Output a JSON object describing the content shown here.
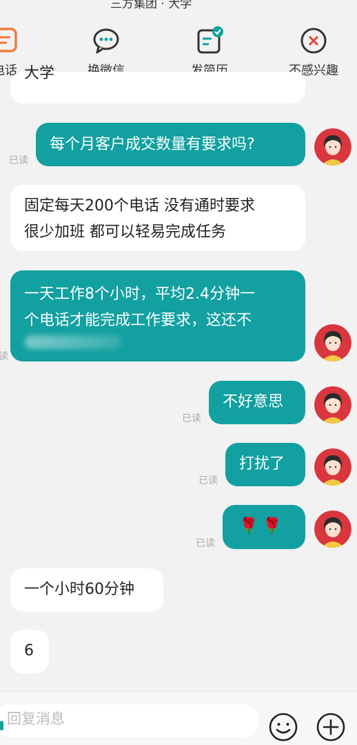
{
  "header": {
    "partial_text": "三方集团 · 大学"
  },
  "actions": [
    {
      "label": "电话",
      "icon": "phone-icon"
    },
    {
      "label": "换微信",
      "icon": "wechat-icon"
    },
    {
      "label": "发简历",
      "icon": "resume-icon"
    },
    {
      "label": "不感兴趣",
      "icon": "not-interested-icon"
    }
  ],
  "chat": {
    "top_partial_text": "大学",
    "messages": [
      {
        "from": "me",
        "text": "每个月客户成交数量有要求吗?",
        "status": "已读"
      },
      {
        "from": "them",
        "lines": [
          "固定每天200个电话 没有通时要求",
          "很少加班 都可以轻易完成任务"
        ]
      },
      {
        "from": "me",
        "lines": [
          "一天工作8个小时，平均2.4分钟一",
          "个电话才能完成工作要求，这还不"
        ],
        "status": "读"
      },
      {
        "from": "me",
        "text": "不好意思",
        "status": "已读"
      },
      {
        "from": "me",
        "text": "打扰了",
        "status": "已读"
      },
      {
        "from": "me",
        "text": "🌹 🌹",
        "status": "已读"
      },
      {
        "from": "them",
        "text": "一个小时60分钟"
      },
      {
        "from": "them",
        "text": "6"
      }
    ]
  },
  "input": {
    "placeholder": "回复消息"
  },
  "colors": {
    "accent": "#12a0a0",
    "danger": "#e0443a",
    "orange": "#f07a3a"
  }
}
